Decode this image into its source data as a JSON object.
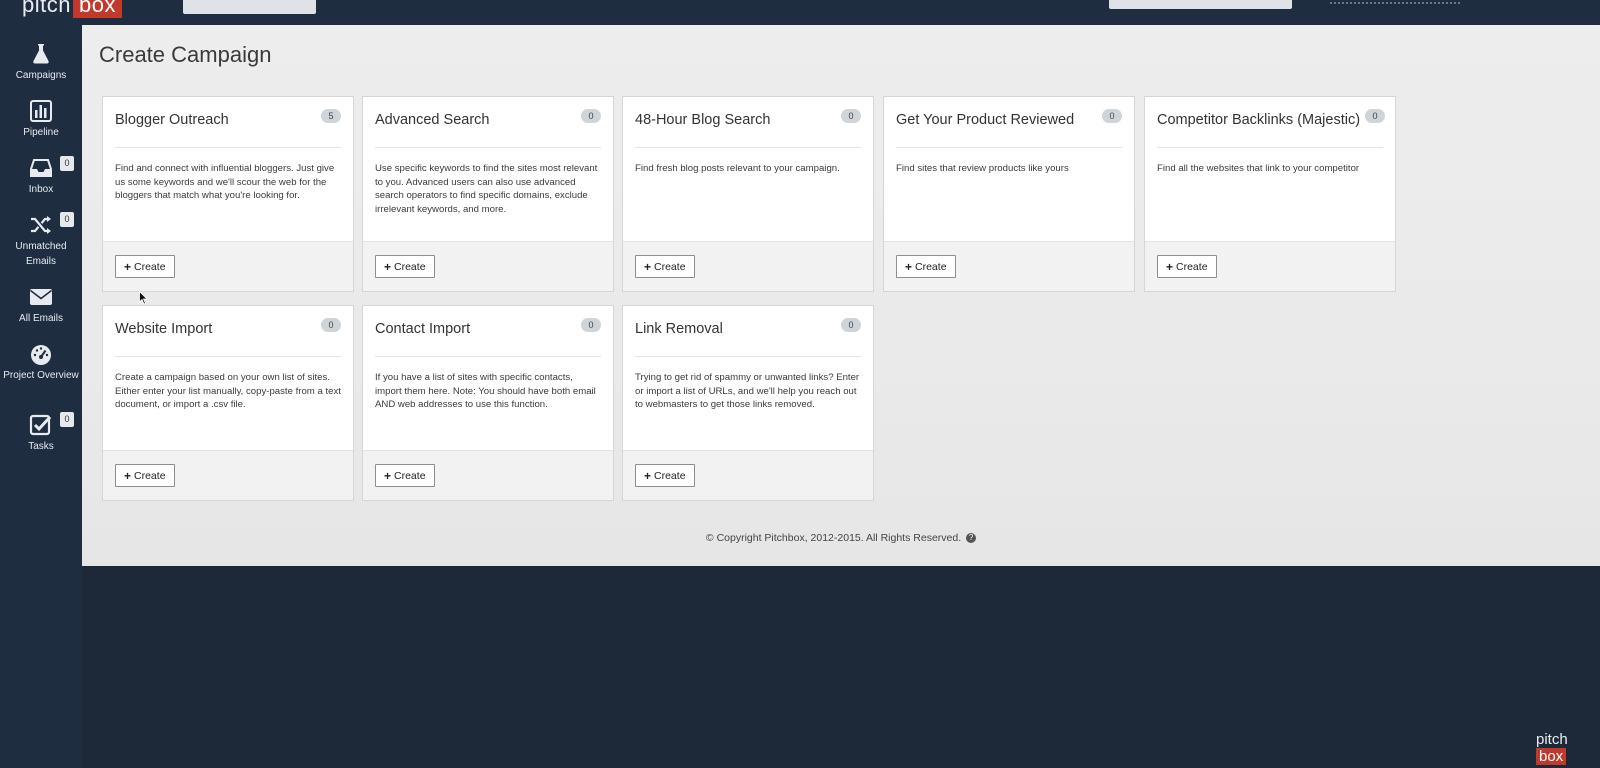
{
  "brand": {
    "logo_left": "pitch",
    "logo_right": "box",
    "accent": "#c0392b"
  },
  "sidebar": {
    "items": [
      {
        "label": "Campaigns",
        "icon": "flask-icon"
      },
      {
        "label": "Pipeline",
        "icon": "bar-chart-icon"
      },
      {
        "label": "Inbox",
        "icon": "inbox-icon",
        "badge": "0"
      },
      {
        "label": "Unmatched Emails",
        "icon": "shuffle-icon",
        "badge": "0"
      },
      {
        "label": "All Emails",
        "icon": "envelope-icon"
      },
      {
        "label": "Project Overview",
        "icon": "dashboard-icon"
      },
      {
        "label": "Tasks",
        "icon": "checkbox-icon",
        "badge": "0"
      }
    ]
  },
  "main": {
    "title": "Create Campaign",
    "create_label": "Create",
    "cards": [
      {
        "title": "Blogger Outreach",
        "count": "5",
        "desc": "Find and connect with influential bloggers. Just give us some keywords and we'll scour the web for the bloggers that match what you're looking for."
      },
      {
        "title": "Advanced Search",
        "count": "0",
        "desc": "Use specific keywords to find the sites most relevant to you. Advanced users can also use advanced search operators to find specific domains, exclude irrelevant keywords, and more."
      },
      {
        "title": "48-Hour Blog Search",
        "count": "0",
        "desc": "Find fresh blog posts relevant to your campaign."
      },
      {
        "title": "Get Your Product Reviewed",
        "count": "0",
        "desc": "Find sites that review products like yours"
      },
      {
        "title": "Competitor Backlinks (Majestic)",
        "count": "0",
        "desc": "Find all the websites that link to your competitor"
      },
      {
        "title": "Website Import",
        "count": "0",
        "desc": "Create a campaign based on your own list of sites. Either enter your list manually, copy-paste from a text document, or import a .csv file."
      },
      {
        "title": "Contact Import",
        "count": "0",
        "desc": "If you have a list of sites with specific contacts, import them here. Note: You should have both email AND web addresses to use this function."
      },
      {
        "title": "Link Removal",
        "count": "0",
        "desc": "Trying to get rid of spammy or unwanted links? Enter or import a list of URLs, and we'll help you reach out to webmasters to get those links removed."
      }
    ],
    "footer": "© Copyright Pitchbox, 2012-2015. All Rights Reserved."
  }
}
